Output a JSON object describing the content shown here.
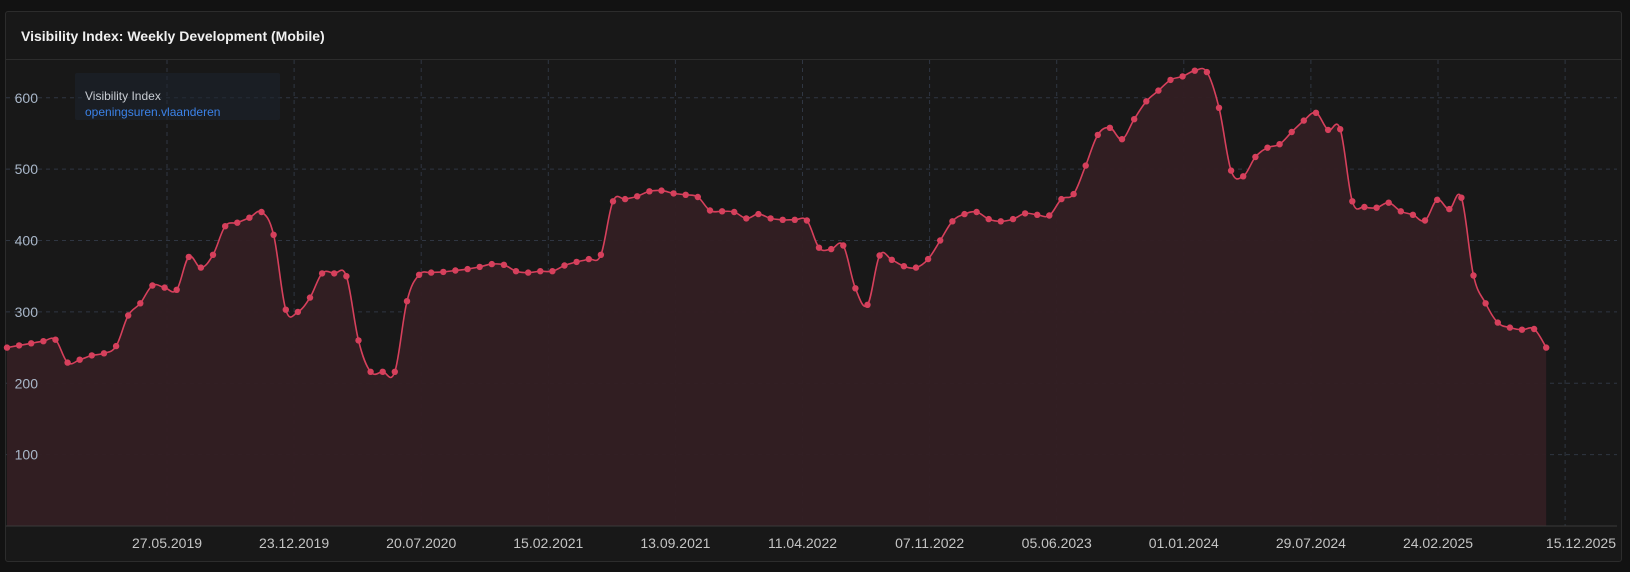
{
  "panel": {
    "title": "Visibility Index: Weekly Development (Mobile)"
  },
  "colors": {
    "line": "#d6405c",
    "fill": "#331f23",
    "point": "#d6405c",
    "grid": "#2f3642",
    "axis_text_y": "#a9b7c9",
    "axis_text_x": "#c4c4c4",
    "legend_series": "#3b82e8"
  },
  "chart_data": {
    "type": "area",
    "title": "Visibility Index: Weekly Development (Mobile)",
    "legend": {
      "title": "Visibility Index",
      "placement": "top-left",
      "entries": [
        "openingsuren.vlaanderen"
      ]
    },
    "xlabel": "",
    "ylabel": "",
    "grid": true,
    "x_ticks": [
      "27.05.2019",
      "23.12.2019",
      "20.07.2020",
      "15.02.2021",
      "13.09.2021",
      "11.04.2022",
      "07.11.2022",
      "05.06.2023",
      "01.01.2024",
      "29.07.2024",
      "24.02.2025",
      "15.12.2025"
    ],
    "y_ticks": [
      100,
      200,
      300,
      400,
      500,
      600
    ],
    "ylim": [
      0,
      650
    ],
    "series": [
      {
        "name": "openingsuren.vlaanderen",
        "points": [
          [
            0,
            250
          ],
          [
            1,
            253
          ],
          [
            2,
            256
          ],
          [
            3,
            259
          ],
          [
            4,
            261
          ],
          [
            5,
            229
          ],
          [
            6,
            233
          ],
          [
            7,
            239
          ],
          [
            8,
            242
          ],
          [
            9,
            252
          ],
          [
            10,
            295
          ],
          [
            11,
            312
          ],
          [
            12,
            337
          ],
          [
            13,
            334
          ],
          [
            14,
            331
          ],
          [
            15,
            377
          ],
          [
            16,
            362
          ],
          [
            17,
            380
          ],
          [
            18,
            420
          ],
          [
            19,
            425
          ],
          [
            20,
            432
          ],
          [
            21,
            440
          ],
          [
            22,
            408
          ],
          [
            23,
            303
          ],
          [
            24,
            300
          ],
          [
            25,
            320
          ],
          [
            26,
            354
          ],
          [
            27,
            354
          ],
          [
            28,
            350
          ],
          [
            29,
            260
          ],
          [
            30,
            216
          ],
          [
            31,
            216
          ],
          [
            32,
            216
          ],
          [
            33,
            315
          ],
          [
            34,
            352
          ],
          [
            35,
            355
          ],
          [
            36,
            356
          ],
          [
            37,
            358
          ],
          [
            38,
            360
          ],
          [
            39,
            363
          ],
          [
            40,
            367
          ],
          [
            41,
            366
          ],
          [
            42,
            357
          ],
          [
            43,
            355
          ],
          [
            44,
            357
          ],
          [
            45,
            357
          ],
          [
            46,
            365
          ],
          [
            47,
            370
          ],
          [
            48,
            374
          ],
          [
            49,
            380
          ],
          [
            50,
            455
          ],
          [
            51,
            458
          ],
          [
            52,
            462
          ],
          [
            53,
            469
          ],
          [
            54,
            470
          ],
          [
            55,
            466
          ],
          [
            56,
            464
          ],
          [
            57,
            461
          ],
          [
            58,
            442
          ],
          [
            59,
            441
          ],
          [
            60,
            440
          ],
          [
            61,
            431
          ],
          [
            62,
            437
          ],
          [
            63,
            431
          ],
          [
            64,
            429
          ],
          [
            65,
            429
          ],
          [
            66,
            428
          ],
          [
            67,
            390
          ],
          [
            68,
            388
          ],
          [
            69,
            393
          ],
          [
            70,
            333
          ],
          [
            71,
            310
          ],
          [
            72,
            379
          ],
          [
            73,
            373
          ],
          [
            74,
            364
          ],
          [
            75,
            362
          ],
          [
            76,
            374
          ],
          [
            77,
            400
          ],
          [
            78,
            427
          ],
          [
            79,
            437
          ],
          [
            80,
            440
          ],
          [
            81,
            430
          ],
          [
            82,
            427
          ],
          [
            83,
            430
          ],
          [
            84,
            438
          ],
          [
            85,
            436
          ],
          [
            86,
            435
          ],
          [
            87,
            458
          ],
          [
            88,
            465
          ],
          [
            89,
            505
          ],
          [
            90,
            548
          ],
          [
            91,
            558
          ],
          [
            92,
            542
          ],
          [
            93,
            570
          ],
          [
            94,
            595
          ],
          [
            95,
            610
          ],
          [
            96,
            625
          ],
          [
            97,
            630
          ],
          [
            98,
            638
          ],
          [
            99,
            636
          ],
          [
            100,
            586
          ],
          [
            101,
            498
          ],
          [
            102,
            490
          ],
          [
            103,
            517
          ],
          [
            104,
            530
          ],
          [
            105,
            535
          ],
          [
            106,
            552
          ],
          [
            107,
            568
          ],
          [
            108,
            579
          ],
          [
            109,
            555
          ],
          [
            110,
            556
          ],
          [
            111,
            455
          ],
          [
            112,
            447
          ],
          [
            113,
            446
          ],
          [
            114,
            453
          ],
          [
            115,
            441
          ],
          [
            116,
            436
          ],
          [
            117,
            428
          ],
          [
            118,
            457
          ],
          [
            119,
            444
          ],
          [
            120,
            460
          ],
          [
            121,
            351
          ],
          [
            122,
            312
          ],
          [
            123,
            285
          ],
          [
            124,
            278
          ],
          [
            125,
            275
          ],
          [
            126,
            276
          ],
          [
            127,
            250
          ]
        ]
      }
    ]
  }
}
